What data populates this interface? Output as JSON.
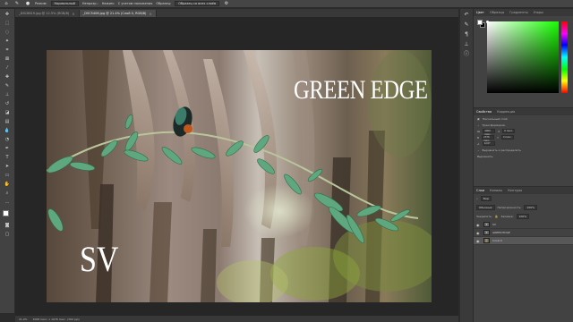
{
  "menubar": {
    "items": [
      "Режим:",
      "Нормальный",
      "Непрозр.:",
      "Нажим:",
      "С учетом наложения",
      "Образец:",
      "Выравнивание",
      "Сглаживание",
      "Образец со всех слоёв"
    ]
  },
  "tabs": [
    {
      "label": "_DSC8819.jpg @ 12.5% (RGB/8)",
      "active": false
    },
    {
      "label": "_DSC5406.jpg @ 21.4% (Слой 0, RGB/8)",
      "active": true
    }
  ],
  "document": {
    "title_text": "GREEN EDGE",
    "signature_text": "SV"
  },
  "statusbar": {
    "zoom": "21,4%",
    "doc_size": "3008 пикс. x 1976 пикс. (300 ppi)"
  },
  "color_panel": {
    "tabs": [
      "Цвет",
      "Образцы",
      "Градиенты",
      "Узоры"
    ],
    "foreground": "#ffffff",
    "background": "#000000",
    "hue_color": "#17ff00"
  },
  "properties_panel": {
    "tabs": [
      "Свойства",
      "Коррекция"
    ],
    "layer_type": "Пиксельный слой",
    "section_title": "Трансформиров.",
    "w_value": "4000 пикс.",
    "h_value": "2376 пикс.",
    "x_value": "0 пикс.",
    "y_value": "0 пикс.",
    "angle_value": "0,00°",
    "align_title": "Выровнять и распределить",
    "align_sub": "Выровнять:"
  },
  "layers_panel": {
    "tabs": [
      "Слои",
      "Каналы",
      "Контуры"
    ],
    "filter_label": "Вид",
    "blend_mode": "Обычные",
    "opacity_label": "Непрозрачность:",
    "opacity": "100%",
    "lock_label": "Закрепить:",
    "fill_label": "Заливка:",
    "fill": "100%",
    "layers": [
      {
        "name": "SV",
        "type": "T",
        "selected": false
      },
      {
        "name": "GREEN EDGE",
        "type": "T",
        "selected": false
      },
      {
        "name": "Слой 0",
        "type": "image",
        "selected": true
      }
    ]
  }
}
